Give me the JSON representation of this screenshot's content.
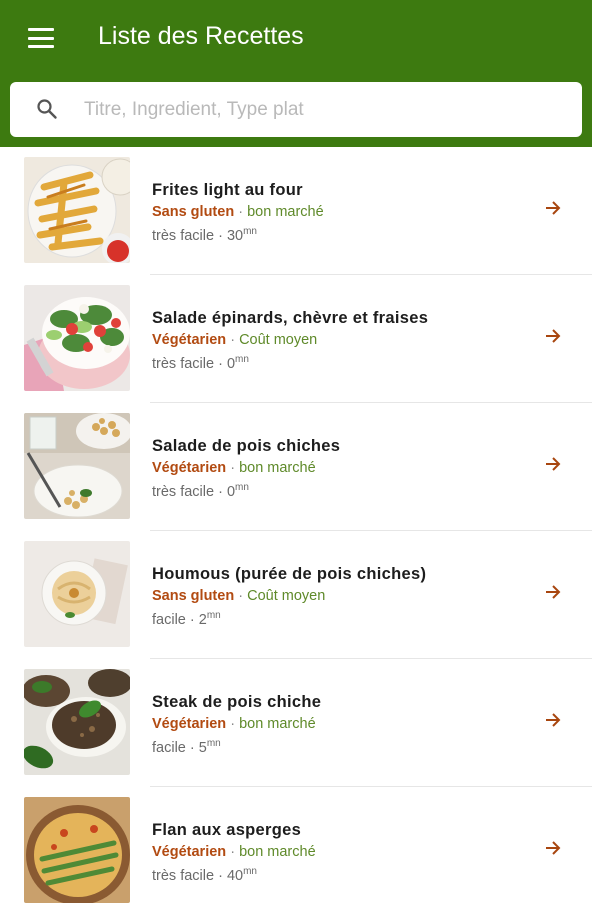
{
  "appbar": {
    "title": "Liste des Recettes",
    "menu_icon": "hamburger-menu-icon",
    "color": "#3d7a10"
  },
  "search": {
    "placeholder": "Titre, Ingredient, Type plat",
    "value": "",
    "icon": "search-icon"
  },
  "colors": {
    "diet_tag": "#b24b12",
    "cost_tag": "#5f8a2a",
    "arrow": "#a8460f"
  },
  "recipes": [
    {
      "title": "Frites light au four",
      "diet": "Sans gluten",
      "separator": "·",
      "cost": "bon marché",
      "difficulty": "très facile ·",
      "time": "30",
      "unit": "mn"
    },
    {
      "title": "Salade épinards, chèvre et fraises",
      "diet": "Végétarien",
      "separator": "·",
      "cost": "Coût moyen",
      "difficulty": "très facile ·",
      "time": "0",
      "unit": "mn"
    },
    {
      "title": "Salade de pois chiches",
      "diet": "Végétarien",
      "separator": "·",
      "cost": "bon marché",
      "difficulty": "très facile ·",
      "time": "0",
      "unit": "mn"
    },
    {
      "title": "Houmous (purée de pois chiches)",
      "diet": "Sans gluten",
      "separator": "·",
      "cost": "Coût moyen",
      "difficulty": "facile ·",
      "time": "2",
      "unit": "mn"
    },
    {
      "title": "Steak de pois chiche",
      "diet": "Végétarien",
      "separator": "·",
      "cost": "bon marché",
      "difficulty": "facile ·",
      "time": "5",
      "unit": "mn"
    },
    {
      "title": "Flan aux asperges",
      "diet": "Végétarien",
      "separator": "·",
      "cost": "bon marché",
      "difficulty": "très facile ·",
      "time": "40",
      "unit": "mn"
    }
  ]
}
